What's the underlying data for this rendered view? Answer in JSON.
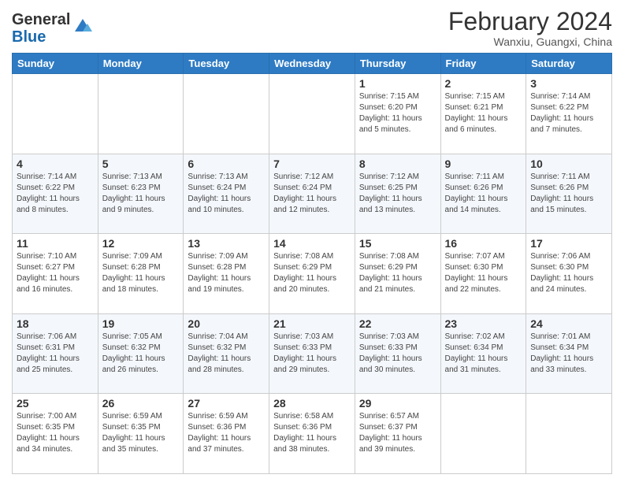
{
  "header": {
    "logo": {
      "general": "General",
      "blue": "Blue"
    },
    "title": "February 2024",
    "subtitle": "Wanxiu, Guangxi, China"
  },
  "days_of_week": [
    "Sunday",
    "Monday",
    "Tuesday",
    "Wednesday",
    "Thursday",
    "Friday",
    "Saturday"
  ],
  "weeks": [
    [
      {
        "day": "",
        "info": ""
      },
      {
        "day": "",
        "info": ""
      },
      {
        "day": "",
        "info": ""
      },
      {
        "day": "",
        "info": ""
      },
      {
        "day": "1",
        "info": "Sunrise: 7:15 AM\nSunset: 6:20 PM\nDaylight: 11 hours and 5 minutes."
      },
      {
        "day": "2",
        "info": "Sunrise: 7:15 AM\nSunset: 6:21 PM\nDaylight: 11 hours and 6 minutes."
      },
      {
        "day": "3",
        "info": "Sunrise: 7:14 AM\nSunset: 6:22 PM\nDaylight: 11 hours and 7 minutes."
      }
    ],
    [
      {
        "day": "4",
        "info": "Sunrise: 7:14 AM\nSunset: 6:22 PM\nDaylight: 11 hours and 8 minutes."
      },
      {
        "day": "5",
        "info": "Sunrise: 7:13 AM\nSunset: 6:23 PM\nDaylight: 11 hours and 9 minutes."
      },
      {
        "day": "6",
        "info": "Sunrise: 7:13 AM\nSunset: 6:24 PM\nDaylight: 11 hours and 10 minutes."
      },
      {
        "day": "7",
        "info": "Sunrise: 7:12 AM\nSunset: 6:24 PM\nDaylight: 11 hours and 12 minutes."
      },
      {
        "day": "8",
        "info": "Sunrise: 7:12 AM\nSunset: 6:25 PM\nDaylight: 11 hours and 13 minutes."
      },
      {
        "day": "9",
        "info": "Sunrise: 7:11 AM\nSunset: 6:26 PM\nDaylight: 11 hours and 14 minutes."
      },
      {
        "day": "10",
        "info": "Sunrise: 7:11 AM\nSunset: 6:26 PM\nDaylight: 11 hours and 15 minutes."
      }
    ],
    [
      {
        "day": "11",
        "info": "Sunrise: 7:10 AM\nSunset: 6:27 PM\nDaylight: 11 hours and 16 minutes."
      },
      {
        "day": "12",
        "info": "Sunrise: 7:09 AM\nSunset: 6:28 PM\nDaylight: 11 hours and 18 minutes."
      },
      {
        "day": "13",
        "info": "Sunrise: 7:09 AM\nSunset: 6:28 PM\nDaylight: 11 hours and 19 minutes."
      },
      {
        "day": "14",
        "info": "Sunrise: 7:08 AM\nSunset: 6:29 PM\nDaylight: 11 hours and 20 minutes."
      },
      {
        "day": "15",
        "info": "Sunrise: 7:08 AM\nSunset: 6:29 PM\nDaylight: 11 hours and 21 minutes."
      },
      {
        "day": "16",
        "info": "Sunrise: 7:07 AM\nSunset: 6:30 PM\nDaylight: 11 hours and 22 minutes."
      },
      {
        "day": "17",
        "info": "Sunrise: 7:06 AM\nSunset: 6:30 PM\nDaylight: 11 hours and 24 minutes."
      }
    ],
    [
      {
        "day": "18",
        "info": "Sunrise: 7:06 AM\nSunset: 6:31 PM\nDaylight: 11 hours and 25 minutes."
      },
      {
        "day": "19",
        "info": "Sunrise: 7:05 AM\nSunset: 6:32 PM\nDaylight: 11 hours and 26 minutes."
      },
      {
        "day": "20",
        "info": "Sunrise: 7:04 AM\nSunset: 6:32 PM\nDaylight: 11 hours and 28 minutes."
      },
      {
        "day": "21",
        "info": "Sunrise: 7:03 AM\nSunset: 6:33 PM\nDaylight: 11 hours and 29 minutes."
      },
      {
        "day": "22",
        "info": "Sunrise: 7:03 AM\nSunset: 6:33 PM\nDaylight: 11 hours and 30 minutes."
      },
      {
        "day": "23",
        "info": "Sunrise: 7:02 AM\nSunset: 6:34 PM\nDaylight: 11 hours and 31 minutes."
      },
      {
        "day": "24",
        "info": "Sunrise: 7:01 AM\nSunset: 6:34 PM\nDaylight: 11 hours and 33 minutes."
      }
    ],
    [
      {
        "day": "25",
        "info": "Sunrise: 7:00 AM\nSunset: 6:35 PM\nDaylight: 11 hours and 34 minutes."
      },
      {
        "day": "26",
        "info": "Sunrise: 6:59 AM\nSunset: 6:35 PM\nDaylight: 11 hours and 35 minutes."
      },
      {
        "day": "27",
        "info": "Sunrise: 6:59 AM\nSunset: 6:36 PM\nDaylight: 11 hours and 37 minutes."
      },
      {
        "day": "28",
        "info": "Sunrise: 6:58 AM\nSunset: 6:36 PM\nDaylight: 11 hours and 38 minutes."
      },
      {
        "day": "29",
        "info": "Sunrise: 6:57 AM\nSunset: 6:37 PM\nDaylight: 11 hours and 39 minutes."
      },
      {
        "day": "",
        "info": ""
      },
      {
        "day": "",
        "info": ""
      }
    ]
  ]
}
